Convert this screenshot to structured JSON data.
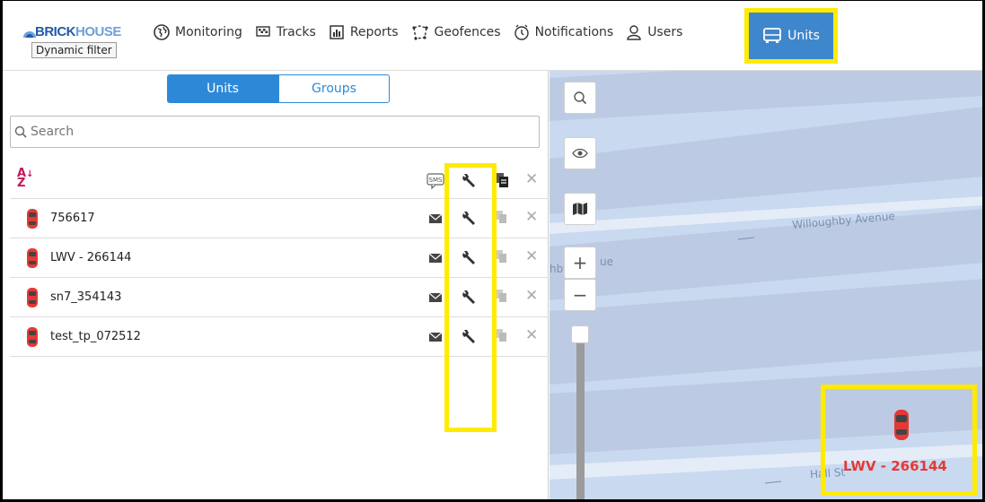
{
  "brand": {
    "part1": "BRICK",
    "part2": "HOUSE",
    "tooltip": "Dynamic filter"
  },
  "nav": {
    "monitoring": "Monitoring",
    "tracks": "Tracks",
    "reports": "Reports",
    "geofences": "Geofences",
    "notifications": "Notifications",
    "users": "Users",
    "units": "Units"
  },
  "panel": {
    "tabs": {
      "units": "Units",
      "groups": "Groups"
    },
    "search_placeholder": "Search",
    "sort_label": "A↓Z",
    "sms_label": "SMS",
    "units": [
      {
        "name": "756617"
      },
      {
        "name": "LWV - 266144"
      },
      {
        "name": "sn7_354143"
      },
      {
        "name": "test_tp_072512"
      }
    ]
  },
  "map": {
    "streets": {
      "willoughby": "Willoughby Avenue",
      "partial_left": "hby",
      "partial_ue": "ue",
      "hall": "Hall St"
    },
    "zoom_in": "+",
    "zoom_out": "−",
    "unit_marker_label": "LWV - 266144"
  },
  "colors": {
    "accent": "#2d89d8",
    "highlight": "#ffeb00",
    "unit_label": "#e53935",
    "map_bg": "#c9d9f0"
  },
  "icons": [
    "globe-icon",
    "flag-icon",
    "report-icon",
    "geofence-icon",
    "clock-icon",
    "user-icon",
    "bus-icon",
    "search-icon",
    "eye-icon",
    "map-icon",
    "car-icon",
    "envelope-icon",
    "wrench-icon",
    "copy-icon",
    "close-icon"
  ]
}
